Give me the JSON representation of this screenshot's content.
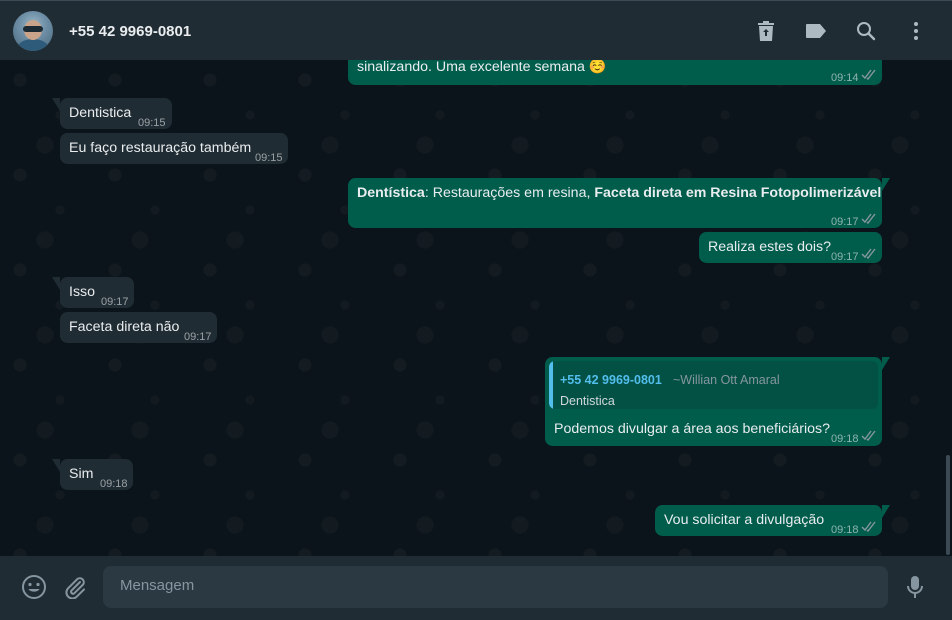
{
  "header": {
    "contact_name": "+55 42 9969-0801"
  },
  "messages": [
    {
      "dir": "out",
      "text": "sinalizando. Uma excelente semana ☺️",
      "time": "09:14"
    },
    {
      "dir": "in",
      "text": "Dentistica",
      "time": "09:15"
    },
    {
      "dir": "in",
      "text": "Eu faço restauração também",
      "time": "09:15"
    },
    {
      "dir": "out",
      "bold1": "Dentística",
      "plain": ": Restaurações em resina, ",
      "bold2": "Faceta direta em Resina Fotopolimerizável",
      "time": "09:17"
    },
    {
      "dir": "out",
      "text": "Realiza estes dois?",
      "time": "09:17"
    },
    {
      "dir": "in",
      "text": "Isso",
      "time": "09:17"
    },
    {
      "dir": "in",
      "text": "Faceta direta não",
      "time": "09:17"
    },
    {
      "dir": "out",
      "quote_author": "+55 42 9969-0801",
      "quote_pushname": "~Willian Ott Amaral",
      "quote_text": "Dentistica",
      "text": "Podemos divulgar a área aos beneficiários?",
      "time": "09:18"
    },
    {
      "dir": "in",
      "text": "Sim",
      "time": "09:18"
    },
    {
      "dir": "out",
      "text": "Vou solicitar a divulgação",
      "time": "09:18"
    }
  ],
  "composer": {
    "placeholder": "Mensagem"
  },
  "colors": {
    "header_bg": "#202c33",
    "chat_bg": "#0b141a",
    "incoming_bubble": "#202c33",
    "outgoing_bubble": "#005c4b",
    "read_tick": "#8696a0",
    "quote_accent": "#53bdeb"
  },
  "icons": {
    "header": [
      "delete-icon",
      "label-icon",
      "search-icon",
      "menu-icon"
    ],
    "composer": [
      "emoji-icon",
      "attach-icon",
      "mic-icon"
    ],
    "status": "double-check-icon"
  }
}
